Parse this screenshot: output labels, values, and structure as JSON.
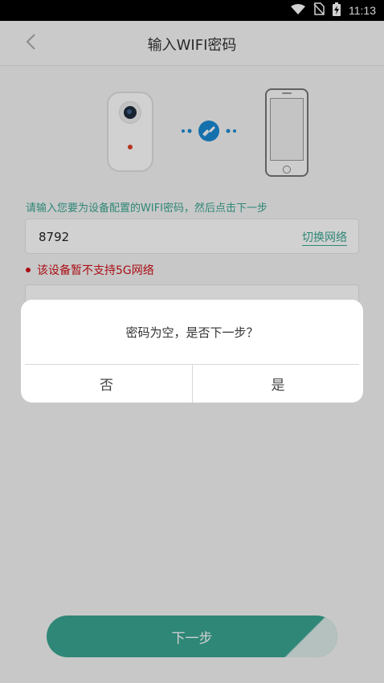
{
  "status_bar": {
    "time": "11:13",
    "icons": [
      "wifi-icon",
      "no-sim-icon",
      "battery-charging-icon"
    ]
  },
  "header": {
    "title": "输入WIFI密码",
    "back_icon": "chevron-left-icon"
  },
  "main": {
    "hint": "请输入您要为设备配置的WIFI密码，然后点击下一步",
    "ssid_value": "8792",
    "switch_network": "切换网络",
    "warning": "该设备暂不支持5G网络",
    "password_placeholder": "",
    "next_button": "下一步"
  },
  "dialog": {
    "message": "密码为空，是否下一步？",
    "no_label": "否",
    "yes_label": "是"
  },
  "colors": {
    "accent": "#3aa592",
    "warning": "#d0121a"
  }
}
